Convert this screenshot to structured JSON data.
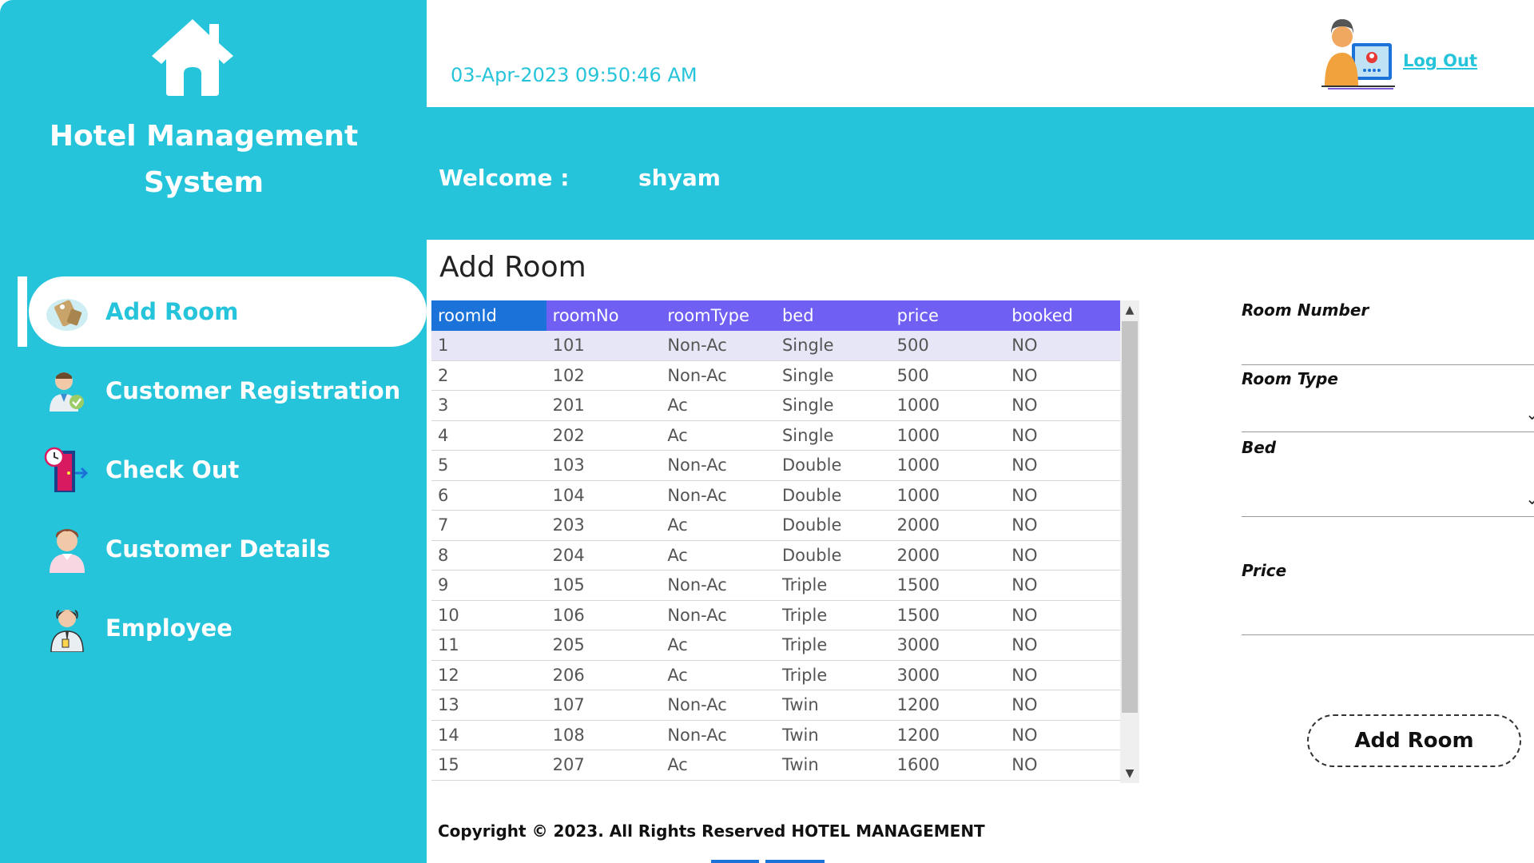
{
  "app": {
    "title_line1": "Hotel Management",
    "title_line2": "System"
  },
  "sidebar": {
    "items": [
      {
        "label": "Add Room",
        "icon": "room-key-icon",
        "active": true
      },
      {
        "label": "Customer Registration",
        "icon": "customer-registration-icon",
        "active": false
      },
      {
        "label": "Check Out",
        "icon": "checkout-door-icon",
        "active": false
      },
      {
        "label": "Customer Details",
        "icon": "customer-icon",
        "active": false
      },
      {
        "label": "Employee",
        "icon": "employee-icon",
        "active": false
      }
    ]
  },
  "header": {
    "datetime": "03-Apr-2023 09:50:46 AM",
    "logout_label": "Log Out",
    "welcome_label": "Welcome :",
    "username": "shyam"
  },
  "main": {
    "page_title": "Add Room",
    "table": {
      "columns": [
        "roomId",
        "roomNo",
        "roomType",
        "bed",
        "price",
        "booked"
      ],
      "rows": [
        [
          "1",
          "101",
          "Non-Ac",
          "Single",
          "500",
          "NO"
        ],
        [
          "2",
          "102",
          "Non-Ac",
          "Single",
          "500",
          "NO"
        ],
        [
          "3",
          "201",
          "Ac",
          "Single",
          "1000",
          "NO"
        ],
        [
          "4",
          "202",
          "Ac",
          "Single",
          "1000",
          "NO"
        ],
        [
          "5",
          "103",
          "Non-Ac",
          "Double",
          "1000",
          "NO"
        ],
        [
          "6",
          "104",
          "Non-Ac",
          "Double",
          "1000",
          "NO"
        ],
        [
          "7",
          "203",
          "Ac",
          "Double",
          "2000",
          "NO"
        ],
        [
          "8",
          "204",
          "Ac",
          "Double",
          "2000",
          "NO"
        ],
        [
          "9",
          "105",
          "Non-Ac",
          "Triple",
          "1500",
          "NO"
        ],
        [
          "10",
          "106",
          "Non-Ac",
          "Triple",
          "1500",
          "NO"
        ],
        [
          "11",
          "205",
          "Ac",
          "Triple",
          "3000",
          "NO"
        ],
        [
          "12",
          "206",
          "Ac",
          "Triple",
          "3000",
          "NO"
        ],
        [
          "13",
          "107",
          "Non-Ac",
          "Twin",
          "1200",
          "NO"
        ],
        [
          "14",
          "108",
          "Non-Ac",
          "Twin",
          "1200",
          "NO"
        ],
        [
          "15",
          "207",
          "Ac",
          "Twin",
          "1600",
          "NO"
        ]
      ],
      "selected_row": 0
    },
    "form": {
      "room_number_label": "Room Number",
      "room_number_value": "",
      "room_type_label": "Room Type",
      "room_type_value": "",
      "bed_label": "Bed",
      "bed_value": "",
      "price_label": "Price",
      "price_value": "",
      "submit_label": "Add Room"
    },
    "copyright": "Copyright © 2023. All Rights Reserved HOTEL MANAGEMENT"
  },
  "colors": {
    "accent": "#26c4da",
    "table_header": "#6f5ff3",
    "table_header_first": "#1b72d8"
  }
}
